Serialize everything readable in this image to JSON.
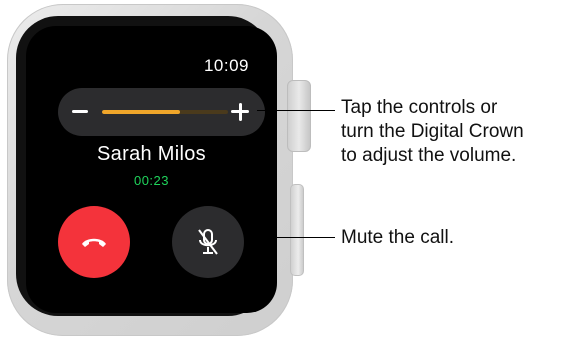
{
  "watch": {
    "time": "10:09",
    "caller_name": "Sarah Milos",
    "call_duration": "00:23",
    "volume_level": 0.62,
    "colors": {
      "end_call": "#f4333b",
      "volume_fill": "#f0a62a",
      "duration_text": "#1fd35b"
    },
    "icons": {
      "end_call": "phone-hangup-icon",
      "mute": "microphone-slash-icon",
      "volume_down": "minus-icon",
      "volume_up": "plus-icon"
    }
  },
  "callouts": {
    "volume": {
      "line1": "Tap the controls or",
      "line2": "turn the Digital Crown",
      "line3": "to adjust the volume."
    },
    "mute": {
      "text": "Mute the call."
    }
  }
}
